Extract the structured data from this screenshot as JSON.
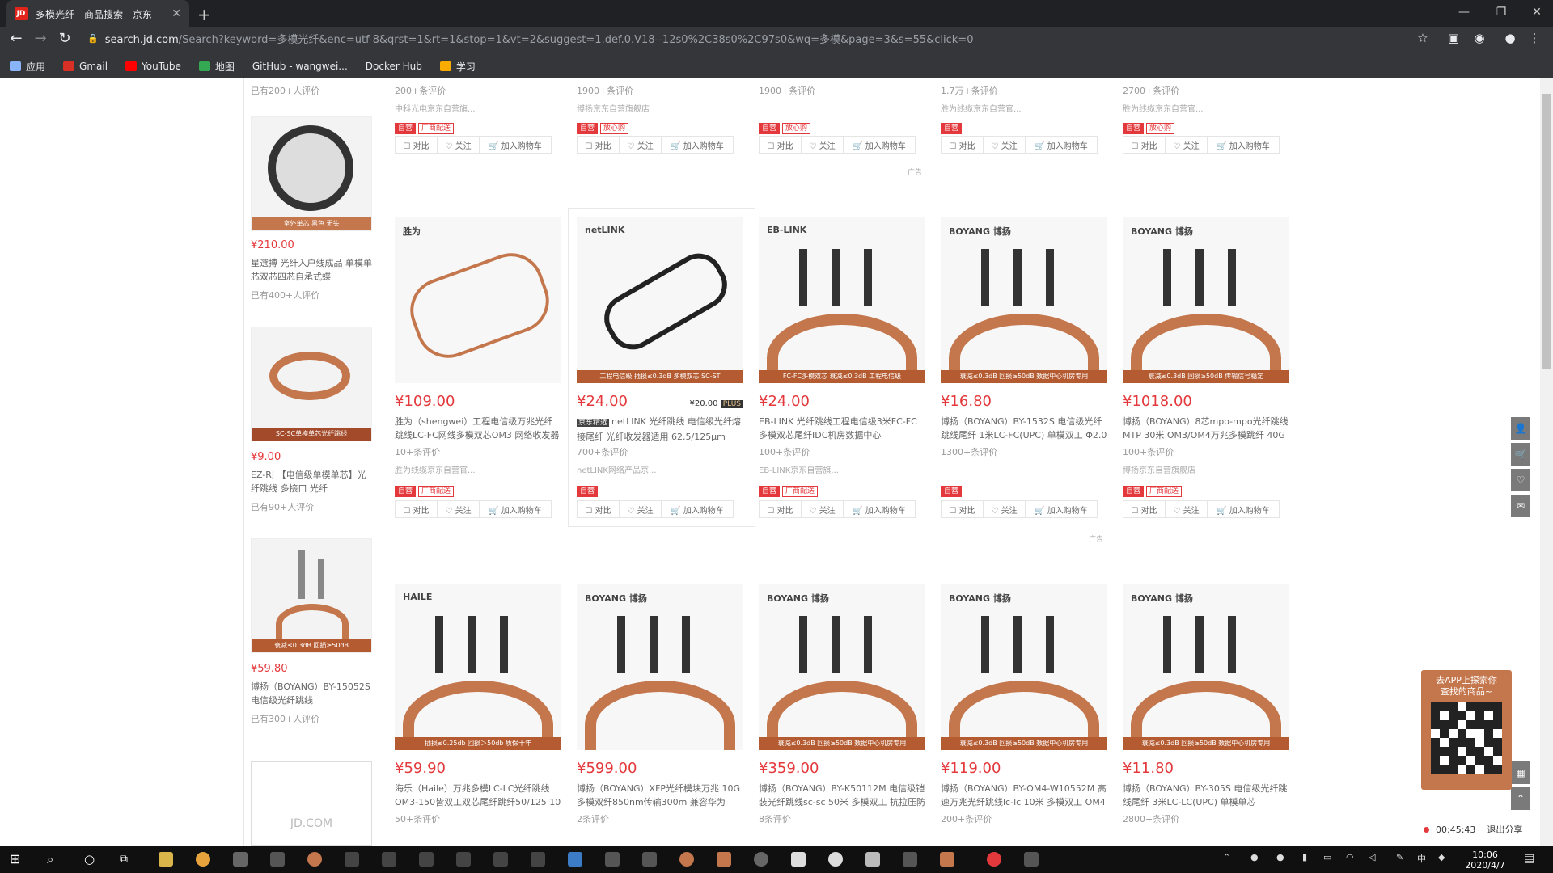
{
  "browser": {
    "tab_title": "多模光纤 - 商品搜索 - 京东",
    "tab_fav": "JD",
    "url_host": "search.jd.com",
    "url_path": "/Search?keyword=多模光纤&enc=utf-8&qrst=1&rt=1&stop=1&vt=2&suggest=1.def.0.V18--12s0%2C38s0%2C97s0&wq=多模&page=3&s=55&click=0",
    "bookmarks": [
      {
        "label": "应用",
        "color": "#8ab4f8"
      },
      {
        "label": "Gmail",
        "color": "#d93025"
      },
      {
        "label": "YouTube",
        "color": "#ff0000"
      },
      {
        "label": "地图",
        "color": "#34a853"
      },
      {
        "label": "GitHub - wangwei...",
        "color": "#333"
      },
      {
        "label": "Docker Hub",
        "color": "#1d63ed"
      },
      {
        "label": "学习",
        "color": "#f9ab00"
      }
    ]
  },
  "sidebar": {
    "top_reviews": "已有200+人评价",
    "items": [
      {
        "price": "¥210.00",
        "name": "星選搏 光纤入户线成品 单模单芯双芯四芯自承式蝶",
        "reviews": "已有400+人评价",
        "banner": "室外单芯 黑色 无头"
      },
      {
        "price": "¥9.00",
        "name": "EZ-RJ 【电信级单模单芯】光纤跳线 多接口 光纤",
        "reviews": "已有90+人评价",
        "banner": "SC-SC单模单芯光纤跳线"
      },
      {
        "price": "¥59.80",
        "name": "博扬（BOYANG）BY-15052S 电信级光纤跳线",
        "reviews": "已有300+人评价",
        "banner": "衰减≤0.3dB 回损≥50dB"
      }
    ],
    "jd_logo": "JD.COM"
  },
  "top_row": [
    {
      "reviews": "200+",
      "shop": "中科光电京东自营旗...",
      "tags": [
        "自营",
        "厂商配送"
      ]
    },
    {
      "reviews": "1900+",
      "shop": "博扬京东自营旗舰店",
      "tags": [
        "自营",
        "放心购"
      ]
    },
    {
      "reviews": "1900+",
      "shop": "",
      "tags": [
        "自营",
        "放心购"
      ]
    },
    {
      "reviews": "1.7万+",
      "shop": "胜为线缆京东自营官...",
      "tags": [
        "自营"
      ]
    },
    {
      "reviews": "2700+",
      "shop": "胜为线缆京东自营官...",
      "tags": [
        "自营",
        "放心购"
      ]
    }
  ],
  "review_suffix": "条评价",
  "actions": {
    "compare": "对比",
    "follow": "关注",
    "cart": "加入购物车"
  },
  "ad_label": "广告",
  "row2": [
    {
      "brand": "胜为",
      "price": "¥109.00",
      "name": "胜为（shengwei）工程电信级万兆光纤跳线LC-FC网线多模双芯OM3 网络收发器尾",
      "reviews": "10+",
      "shop": "胜为线缆京东自营官...",
      "tags": [
        "自营",
        "厂商配送"
      ],
      "banner": ""
    },
    {
      "brand": "netLINK",
      "price": "¥24.00",
      "plus": "¥20.00",
      "plus_tag": "PLUS",
      "jdpick": "京东精选",
      "name": "netLINK 光纤跳线 电信级光纤熔接尾纤 光纤收发器适用 62.5/125μm",
      "reviews": "700+",
      "shop": "netLINK网络产品京...",
      "tags": [
        "自营"
      ],
      "banner": "工程电信级 插损≤0.3dB 多模双芯 SC-ST"
    },
    {
      "brand": "EB-LINK",
      "price": "¥24.00",
      "name": "EB-LINK 光纤跳线工程电信级3米FC-FC多模双芯尾纤IDC机房数据中心",
      "reviews": "100+",
      "shop": "EB-LINK京东自营旗...",
      "tags": [
        "自营",
        "厂商配送"
      ],
      "banner": "FC-FC多模双芯 衰减≤0.3dB 工程电信级"
    },
    {
      "brand": "BOYANG 博扬",
      "price": "¥16.80",
      "name": "博扬（BOYANG）BY-1532S 电信级光纤跳线尾纤 1米LC-FC(UPC) 单模双工 Φ2.0",
      "reviews": "1300+",
      "shop": "",
      "tags": [
        "自营"
      ],
      "banner": "衰减≤0.3dB 回损≥50dB 数据中心机房专用"
    },
    {
      "brand": "BOYANG 博扬",
      "price": "¥1018.00",
      "name": "博扬（BOYANG）8芯mpo-mpo光纤跳线 MTP 30米 OM3/OM4万兆多模跳纤 40G光",
      "reviews": "100+",
      "shop": "博扬京东自营旗舰店",
      "tags": [
        "自营",
        "厂商配送"
      ],
      "banner": "衰减≤0.3dB 回损≥50dB 传输信号稳定"
    }
  ],
  "row3": [
    {
      "brand": "HAILE",
      "price": "¥59.90",
      "name": "海乐（Haile）万兆多模LC-LC光纤跳线 OM3-150皆双工双芯尾纤跳纤50/125 10",
      "reviews": "50+",
      "banner": "插损≤0.25db 回损＞50db 质保十年"
    },
    {
      "brand": "BOYANG 博扬",
      "price": "¥599.00",
      "name": "博扬（BOYANG）XFP光纤模块万兆 10G 多模双纤850nm传输300m 兼容华为H3C",
      "reviews": "2",
      "banner": ""
    },
    {
      "brand": "BOYANG 博扬",
      "price": "¥359.00",
      "name": "博扬（BOYANG）BY-K50112M 电信级铠装光纤跳线sc-sc 50米 多模双工 抗拉压防",
      "reviews": "8",
      "banner": "衰减≤0.3dB 回损≥50dB 数据中心机房专用"
    },
    {
      "brand": "BOYANG 博扬",
      "price": "¥119.00",
      "name": "博扬（BOYANG）BY-OM4-W10552M 高速万兆光纤跳线lc-lc 10米 多模双工 OM4",
      "reviews": "200+",
      "banner": "衰减≤0.3dB 回损≥50dB 数据中心机房专用"
    },
    {
      "brand": "BOYANG 博扬",
      "price": "¥11.80",
      "name": "博扬（BOYANG）BY-305S 电信级光纤跳线尾纤 3米LC-LC(UPC) 单模单芯 Φ2.0mm",
      "reviews": "2800+",
      "banner": "衰减≤0.3dB 回损≥50dB 数据中心机房专用"
    }
  ],
  "qr": {
    "line1": "去APP上探索你",
    "line2": "查找的商品~"
  },
  "recorder": {
    "time": "00:45:43",
    "label": "退出分享"
  },
  "clock": {
    "time": "10:06",
    "date": "2020/4/7"
  },
  "tray": {
    "ime": "中"
  }
}
